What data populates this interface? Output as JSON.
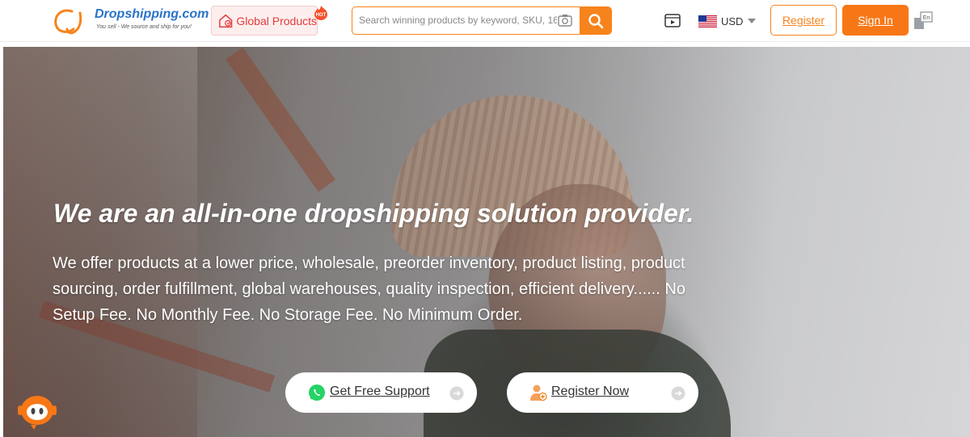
{
  "header": {
    "logo": {
      "name": "Dropshipping.com",
      "tagline": "You sell - We source and ship for you!"
    },
    "global_products": {
      "label": "Global Products",
      "badge": "HOT"
    },
    "search": {
      "placeholder": "Search winning products by keyword, SKU, 168...",
      "icon": "search-icon",
      "camera_icon": "camera-icon"
    },
    "video_icon": "video-icon",
    "currency": {
      "label": "USD",
      "flag": "us-flag"
    },
    "register_label": "Register",
    "signin_label": "Sign In",
    "language": {
      "label": "En",
      "icon": "language-icon"
    }
  },
  "hero": {
    "title": "We are an all-in-one dropshipping solution provider.",
    "description": "We offer products at a lower price, wholesale, preorder inventory, product listing, product sourcing, order fulfillment, global warehouses, quality inspection, efficient delivery...... No Setup Fee. No Monthly Fee. No Storage Fee. No Minimum Order.",
    "cta_support": {
      "label": "Get Free Support",
      "icon": "whatsapp-icon"
    },
    "cta_register": {
      "label": "Register Now",
      "icon": "user-register-icon"
    }
  },
  "chat_bot": {
    "icon": "robot-chat-icon"
  },
  "colors": {
    "accent": "#f7831c",
    "hot": "#e23c3c",
    "link_blue": "#2a73c9"
  }
}
